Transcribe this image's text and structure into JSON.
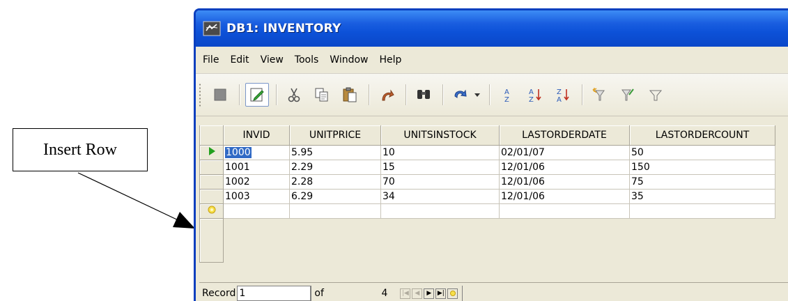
{
  "callout": {
    "label": "Insert Row"
  },
  "window": {
    "title": "DB1: INVENTORY",
    "title_bar_color": "#0c51d8"
  },
  "menu": [
    {
      "label": "File"
    },
    {
      "label": "Edit"
    },
    {
      "label": "View"
    },
    {
      "label": "Tools"
    },
    {
      "label": "Window"
    },
    {
      "label": "Help"
    }
  ],
  "toolbar": {
    "icons": [
      "save-record-icon",
      "edit-data-icon",
      "cut-icon",
      "copy-icon",
      "paste-icon",
      "undo-icon",
      "find-icon",
      "redo-icon",
      "dropdown-arrow-icon",
      "sort-icon",
      "sort-ascending-icon",
      "sort-descending-icon",
      "autofilter-icon",
      "standard-filter-icon",
      "filter-icon"
    ]
  },
  "grid": {
    "columns": [
      "INVID",
      "UNITPRICE",
      "UNITSINSTOCK",
      "LASTORDERDATE",
      "LASTORDERCOUNT"
    ],
    "rows": [
      [
        "1000",
        "5.95",
        "10",
        "02/01/07",
        "50"
      ],
      [
        "1001",
        "2.29",
        "15",
        "12/01/06",
        "150"
      ],
      [
        "1002",
        "2.28",
        "70",
        "12/01/06",
        "75"
      ],
      [
        "1003",
        "6.29",
        "34",
        "12/01/06",
        "35"
      ]
    ],
    "current_row_indicator": "current-row-arrow-icon",
    "new_row_indicator": "new-row-star-icon",
    "accent": "#22a01e",
    "selection_color": "#316ac5"
  },
  "status": {
    "record_label": "Record",
    "record_value": "1",
    "of_label": "of",
    "total": "4"
  }
}
